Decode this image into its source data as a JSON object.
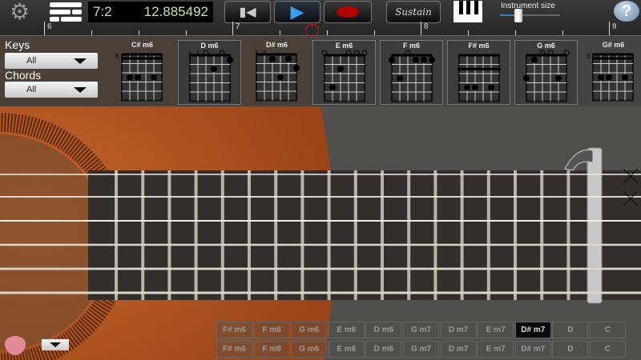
{
  "toolbar": {
    "position": "7:2",
    "time": "12.885492",
    "sustain_label": "Sustain",
    "instrument_size_label": "Instrument size",
    "instrument_size_value": 0.3,
    "help_label": "?"
  },
  "ruler": {
    "measures": [
      "6",
      "7",
      "8",
      "9"
    ]
  },
  "filters": {
    "keys_label": "Keys",
    "keys_value": "All",
    "chords_label": "Chords",
    "chords_value": "All"
  },
  "chords": [
    {
      "name": "C# m6",
      "fret": "8",
      "barre": true,
      "dots": [
        [
          1,
          3
        ],
        [
          2,
          3
        ],
        [
          4,
          3
        ]
      ],
      "marks": ""
    },
    {
      "name": "D m6",
      "dots": [
        [
          5,
          1
        ],
        [
          3,
          2
        ]
      ],
      "marks": "xxo-o-",
      "selected": true
    },
    {
      "name": "D# m6",
      "dots": [
        [
          2,
          1
        ],
        [
          4,
          1
        ],
        [
          5,
          2
        ],
        [
          3,
          3
        ]
      ],
      "marks": "xx----"
    },
    {
      "name": "E m6",
      "dots": [
        [
          2,
          2
        ],
        [
          1,
          4
        ]
      ],
      "marks": "o--ooo"
    },
    {
      "name": "F m6",
      "dots": [
        [
          0,
          1
        ],
        [
          3,
          1
        ],
        [
          4,
          1
        ],
        [
          5,
          1
        ],
        [
          1,
          3
        ]
      ],
      "marks": "--o---"
    },
    {
      "name": "F# m6",
      "barre2": true,
      "dots": [
        [
          1,
          4
        ],
        [
          2,
          4
        ],
        [
          4,
          4
        ]
      ],
      "marks": ""
    },
    {
      "name": "G m6",
      "dots": [
        [
          1,
          1
        ],
        [
          0,
          3
        ],
        [
          4,
          3
        ]
      ],
      "marks": "--oo-o"
    },
    {
      "name": "G# m6",
      "fret": "3",
      "barre": true,
      "dots": [
        [
          1,
          3
        ],
        [
          2,
          3
        ],
        [
          4,
          3
        ]
      ],
      "marks": ""
    }
  ],
  "chord_buttons": [
    [
      "F# m6",
      "F m6",
      "G m6",
      "E m6",
      "D m6",
      "G m7",
      "D m7",
      "E m7",
      "D# m7",
      "D",
      "C"
    ],
    [
      "F# m6",
      "F m6",
      "G m6",
      "E m6",
      "D m6",
      "G m7",
      "D m7",
      "E m7",
      "D# m7",
      "D",
      "C"
    ]
  ],
  "active_chord_button": 8,
  "colors": {
    "record": "#b00000",
    "play": "#3a9ff0",
    "guitar_body": "#b5521d",
    "fretboard": "#3b3330"
  }
}
